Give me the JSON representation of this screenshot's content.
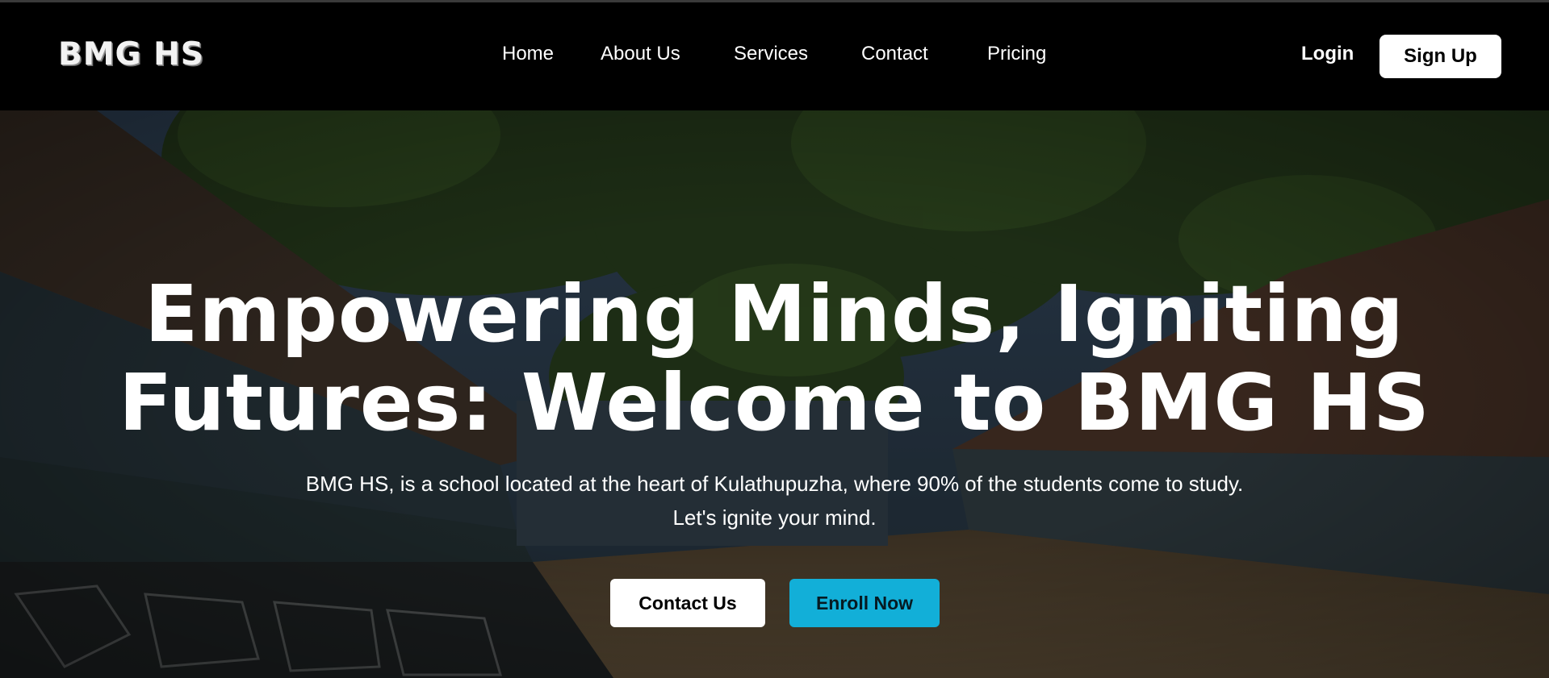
{
  "header": {
    "logo": "BMG HS",
    "nav": [
      "Home",
      "About Us",
      "Services",
      "Contact",
      "Pricing"
    ],
    "login_label": "Login",
    "signup_label": "Sign Up"
  },
  "hero": {
    "title_line1": "Empowering Minds, Igniting",
    "title_line2": "Futures: Welcome to BMG HS",
    "subtitle_line1": "BMG HS, is a school located at the heart of Kulathupuzha, where 90% of the students come to study.",
    "subtitle_line2": "Let's ignite your mind.",
    "contact_button": "Contact Us",
    "enroll_button": "Enroll Now",
    "accent_color": "#12afd8",
    "background": "school-campus-photo"
  }
}
